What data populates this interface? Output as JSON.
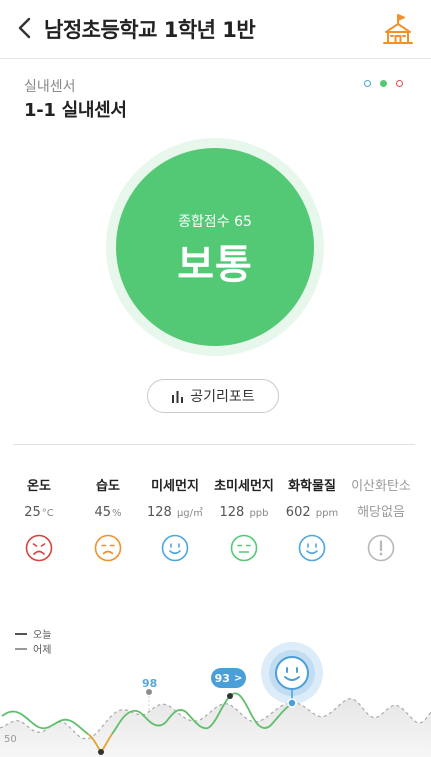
{
  "header": {
    "title": "남정초등학교 1학년 1반",
    "back_icon": "chevron-left-icon",
    "school_icon": "school-icon",
    "accent": "#f0912e"
  },
  "device": {
    "category": "실내센서",
    "name": "1-1 실내센서",
    "pager_colors": [
      "#4aa8de",
      "#53c975",
      "#e2504a"
    ],
    "active_page": 2
  },
  "score": {
    "label": "종합점수 65",
    "grade": "보통",
    "color": "#53c975"
  },
  "report_button": {
    "label": "공기리포트",
    "icon": "bar-chart-icon"
  },
  "metrics": [
    {
      "label": "온도",
      "value": "25",
      "unit": "°C",
      "status": "bad",
      "color": "#d9413c"
    },
    {
      "label": "습도",
      "value": "45",
      "unit": "%",
      "status": "poor",
      "color": "#f0912e"
    },
    {
      "label": "미세먼지",
      "value": "128",
      "unit": "μg/㎥",
      "status": "good",
      "color": "#4aa8de"
    },
    {
      "label": "초미세먼지",
      "value": "128",
      "unit": "ppb",
      "status": "normal",
      "color": "#53c975"
    },
    {
      "label": "화학물질",
      "value": "602",
      "unit": "ppm",
      "status": "good",
      "color": "#4aa8de"
    },
    {
      "label": "이산화탄소",
      "value": "해당없음",
      "unit": "",
      "status": "na",
      "color": "#b8b8b8"
    }
  ],
  "chart": {
    "legend_today": "오늘",
    "legend_yesterday": "어제",
    "axis_label": "50",
    "peak_label": "98",
    "current_label": "93",
    "current_chevron": ">"
  }
}
